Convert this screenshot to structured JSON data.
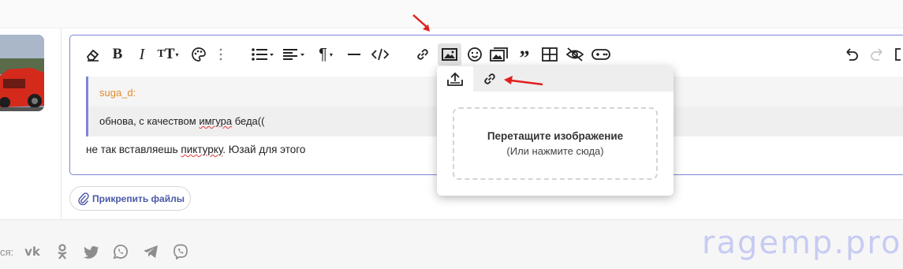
{
  "toolbar": {
    "buttons": [
      {
        "name": "eraser-icon",
        "title": "Remove formatting"
      },
      {
        "name": "bold-icon",
        "title": "Bold"
      },
      {
        "name": "italic-icon",
        "title": "Italic"
      },
      {
        "name": "font-size-icon",
        "title": "Font size"
      },
      {
        "name": "palette-icon",
        "title": "Text color"
      },
      {
        "name": "more-vertical-icon",
        "title": "More"
      },
      {
        "name": "list-icon",
        "title": "List"
      },
      {
        "name": "align-icon",
        "title": "Alignment"
      },
      {
        "name": "paragraph-icon",
        "title": "Paragraph format"
      },
      {
        "name": "horizontal-line-icon",
        "title": "Horizontal line"
      },
      {
        "name": "code-icon",
        "title": "Code"
      },
      {
        "name": "link-icon",
        "title": "Insert link"
      },
      {
        "name": "image-icon",
        "title": "Insert image"
      },
      {
        "name": "smile-icon",
        "title": "Smilies"
      },
      {
        "name": "media-icon",
        "title": "Media"
      },
      {
        "name": "quote-icon",
        "title": "Quote"
      },
      {
        "name": "table-icon",
        "title": "Table"
      },
      {
        "name": "spoiler-icon",
        "title": "Spoiler"
      },
      {
        "name": "gamepad-icon",
        "title": "Game"
      },
      {
        "name": "undo-icon",
        "title": "Undo"
      },
      {
        "name": "redo-icon",
        "title": "Redo"
      }
    ]
  },
  "quote": {
    "author": "suga_d:",
    "text_before": "обнова, с качеством ",
    "text_underlined": "имгура",
    "text_after": " беда(("
  },
  "reply": {
    "text_before": "не так вставляешь ",
    "text_underlined": "пиктурку",
    "text_after": ". Юзай для этого"
  },
  "image_popup": {
    "tabs": [
      {
        "name": "upload-icon",
        "selected": true
      },
      {
        "name": "link-icon",
        "selected": false
      }
    ],
    "drop_title": "Перетащите изображение",
    "drop_subtitle": "(Или нажмите сюда)"
  },
  "attach_button": {
    "label": "Прикрепить файлы",
    "icon": "paperclip-icon"
  },
  "footer": {
    "share_label": "ся:",
    "social": [
      "vk-icon",
      "odnoklassniki-icon",
      "twitter-icon",
      "whatsapp-icon",
      "telegram-icon",
      "viber-icon"
    ],
    "watermark": "ragemp.pro"
  },
  "colors": {
    "accent": "#7f86d6",
    "quote_author": "#e38b2c",
    "annotation_arrow": "#e02020",
    "link_text": "#4a58a8"
  }
}
